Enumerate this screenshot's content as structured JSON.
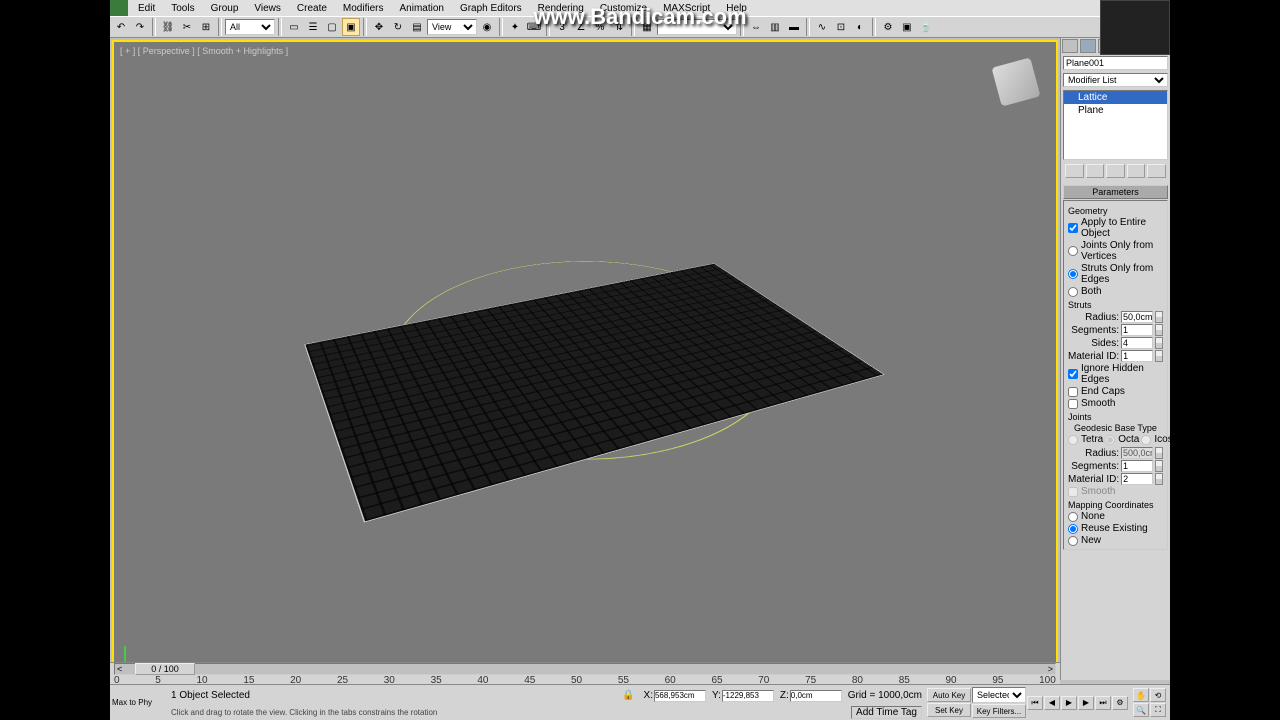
{
  "watermark": "www.Bandicam.com",
  "menu": {
    "items": [
      "Edit",
      "Tools",
      "Group",
      "Views",
      "Create",
      "Modifiers",
      "Animation",
      "Graph Editors",
      "Rendering",
      "Customize",
      "MAXScript",
      "Help"
    ]
  },
  "toolbar": {
    "filter_all": "All",
    "view_mode": "View"
  },
  "viewport": {
    "label": "[ + ] [ Perspective ] [ Smooth + Highlights ]"
  },
  "rightpanel": {
    "object_name": "Plane001",
    "modifier_list_label": "Modifier List",
    "stack": [
      "Lattice",
      "Plane"
    ],
    "rollout_title": "Parameters",
    "geometry_label": "Geometry",
    "apply_entire": "Apply to Entire Object",
    "joints_only": "Joints Only from Vertices",
    "struts_only": "Struts Only from Edges",
    "both": "Both",
    "struts_label": "Struts",
    "radius_label": "Radius:",
    "struts_radius": "50,0cm",
    "segments_label": "Segments:",
    "struts_segments": "1",
    "sides_label": "Sides:",
    "struts_sides": "4",
    "matid_label": "Material ID:",
    "struts_matid": "1",
    "ignore_hidden": "Ignore Hidden Edges",
    "end_caps": "End Caps",
    "smooth": "Smooth",
    "joints_label": "Joints",
    "geo_base_label": "Geodesic Base Type",
    "tetra": "Tetra",
    "octa": "Octa",
    "icosa": "Icosa",
    "joints_radius": "500,0cm",
    "joints_segments": "1",
    "joints_matid": "2",
    "mapping_label": "Mapping Coordinates",
    "map_none": "None",
    "map_reuse": "Reuse Existing",
    "map_new": "New"
  },
  "timeline": {
    "pos": "0 / 100",
    "ticks": [
      "0",
      "5",
      "10",
      "15",
      "20",
      "25",
      "30",
      "35",
      "40",
      "45",
      "50",
      "55",
      "60",
      "65",
      "70",
      "75",
      "80",
      "85",
      "90",
      "95",
      "100"
    ]
  },
  "status": {
    "script": "Max to Phy",
    "selection": "1 Object Selected",
    "x_label": "X:",
    "x": "568,953cm",
    "y_label": "Y:",
    "y": "-1229,853",
    "z_label": "Z:",
    "z": "0,0cm",
    "grid": "Grid = 1000,0cm",
    "hint": "Click and drag to rotate the view.  Clicking in the tabs constrains the rotation",
    "autokey": "Auto Key",
    "setkey": "Set Key",
    "selected": "Selected",
    "keyfilters": "Key Filters...",
    "timetag": "Add Time Tag"
  }
}
